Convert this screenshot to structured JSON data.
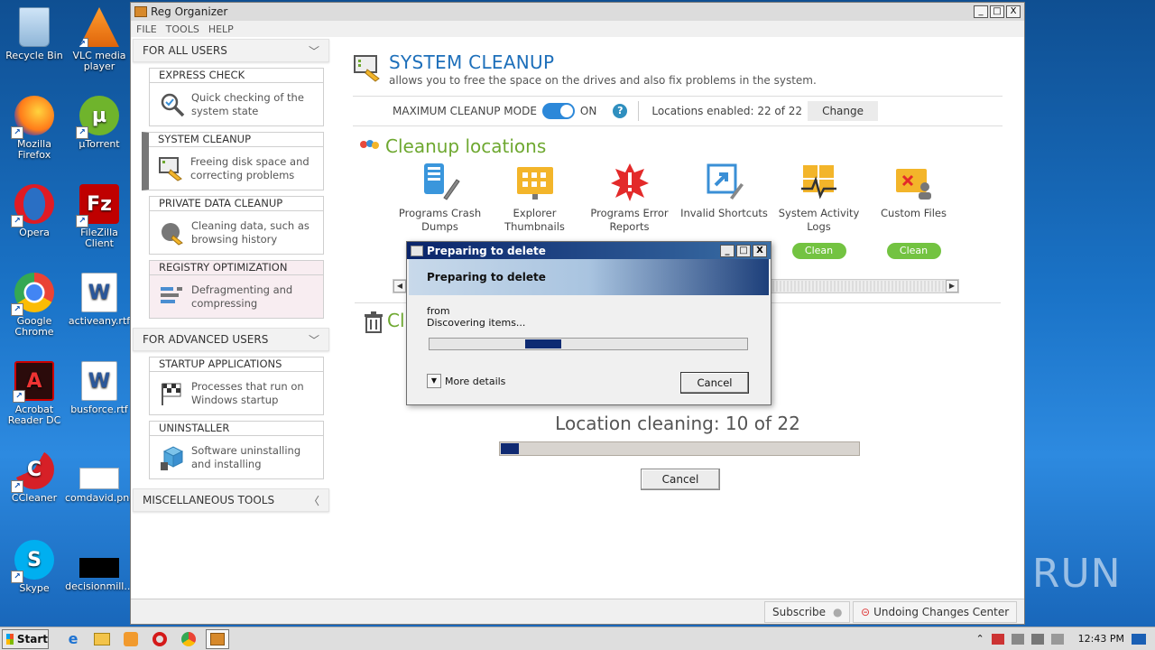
{
  "desktop": {
    "icons": [
      {
        "label": "Recycle Bin"
      },
      {
        "label": "VLC media player"
      },
      {
        "label": "Mozilla Firefox"
      },
      {
        "label": "µTorrent"
      },
      {
        "label": "Opera"
      },
      {
        "label": "FileZilla Client"
      },
      {
        "label": "Google Chrome"
      },
      {
        "label": "activeany.rtf"
      },
      {
        "label": "Acrobat Reader DC"
      },
      {
        "label": "busforce.rtf"
      },
      {
        "label": "CCleaner"
      },
      {
        "label": "comdavid.png"
      },
      {
        "label": "Skype"
      },
      {
        "label": "decisionmill..."
      }
    ],
    "watermark": "ANY RUN"
  },
  "window": {
    "title": "Reg Organizer",
    "menu": [
      "FILE",
      "TOOLS",
      "HELP"
    ],
    "controls": {
      "minimize": "_",
      "maximize": "□",
      "close": "X"
    }
  },
  "sidebar": {
    "for_all_users": "FOR ALL USERS",
    "for_advanced_users": "FOR ADVANCED USERS",
    "misc_tools": "MISCELLANEOUS TOOLS",
    "tiles": [
      {
        "title": "EXPRESS CHECK",
        "desc1": "Quick checking of the",
        "desc2": "system state"
      },
      {
        "title": "SYSTEM CLEANUP",
        "desc1": "Freeing disk space and",
        "desc2": "correcting problems"
      },
      {
        "title": "PRIVATE DATA CLEANUP",
        "desc1": "Cleaning data, such as",
        "desc2": "browsing history"
      },
      {
        "title": "REGISTRY OPTIMIZATION",
        "desc1": "Defragmenting and",
        "desc2": "compressing"
      },
      {
        "title": "STARTUP APPLICATIONS",
        "desc1": "Processes that run on",
        "desc2": "Windows startup"
      },
      {
        "title": "UNINSTALLER",
        "desc1": "Software uninstalling",
        "desc2": "and installing"
      }
    ]
  },
  "main": {
    "title": "SYSTEM CLEANUP",
    "subtitle": "allows you to free the space on the drives and also fix problems in the system.",
    "mode_label": "MAXIMUM CLEANUP MODE",
    "mode_state": "ON",
    "locations_enabled": "Locations enabled: 22 of 22",
    "change_label": "Change",
    "cleanup_locations": "Cleanup locations",
    "locations": [
      {
        "line1": "Programs Crash",
        "line2": "Dumps"
      },
      {
        "line1": "Explorer",
        "line2": "Thumbnails"
      },
      {
        "line1": "Programs Error",
        "line2": "Reports"
      },
      {
        "line1": "Invalid Shortcuts",
        "line2": ""
      },
      {
        "line1": "System Activity",
        "line2": "Logs"
      },
      {
        "line1": "Custom Files",
        "line2": ""
      }
    ],
    "clean_label": "Clean",
    "cl_partial": "Cl",
    "location_cleaning": "Location cleaning: 10 of 22",
    "cleaning_progress_fraction": 0.05,
    "cancel_label": "Cancel"
  },
  "statusbar": {
    "subscribe": "Subscribe",
    "undo_center": "Undoing Changes Center"
  },
  "dialog": {
    "title": "Preparing to delete",
    "heading": "Preparing to delete",
    "from": "from",
    "status": "Discovering items...",
    "more_details": "More details",
    "cancel": "Cancel"
  },
  "taskbar": {
    "start": "Start",
    "time": "12:43 PM"
  },
  "colors": {
    "accent_blue": "#1d6fba",
    "accent_green": "#6ea830",
    "clean_button": "#73c341",
    "progress_fill": "#102a72"
  }
}
